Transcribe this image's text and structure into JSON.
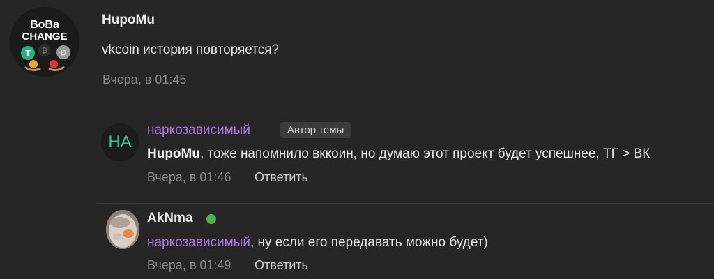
{
  "main_comment": {
    "avatar_logo_text": [
      "BoBa",
      "CHANGE"
    ],
    "author": "HupoMu",
    "text": "vkcoin история повторяется?",
    "time": "Вчера, в 01:45"
  },
  "replies": [
    {
      "avatar_initials": "НА",
      "author": "наркозависимый",
      "badge": "Автор темы",
      "mention": "HupoMu",
      "text_rest": ", тоже напомнило вккоин, но думаю этот проект будет успешнее, ТГ > ВК",
      "time": "Вчера, в 01:46",
      "reply_label": "Ответить"
    },
    {
      "author": "AkNma",
      "online": true,
      "mention": "наркозависимый",
      "text_rest": ", ну если его передавать можно будет)",
      "time": "Вчера, в 01:49",
      "reply_label": "Ответить"
    }
  ],
  "colors": {
    "background": "#262626",
    "mention_purple": "#b573e6",
    "online_green": "#4caf50",
    "initials_teal": "#3fbf8f"
  }
}
